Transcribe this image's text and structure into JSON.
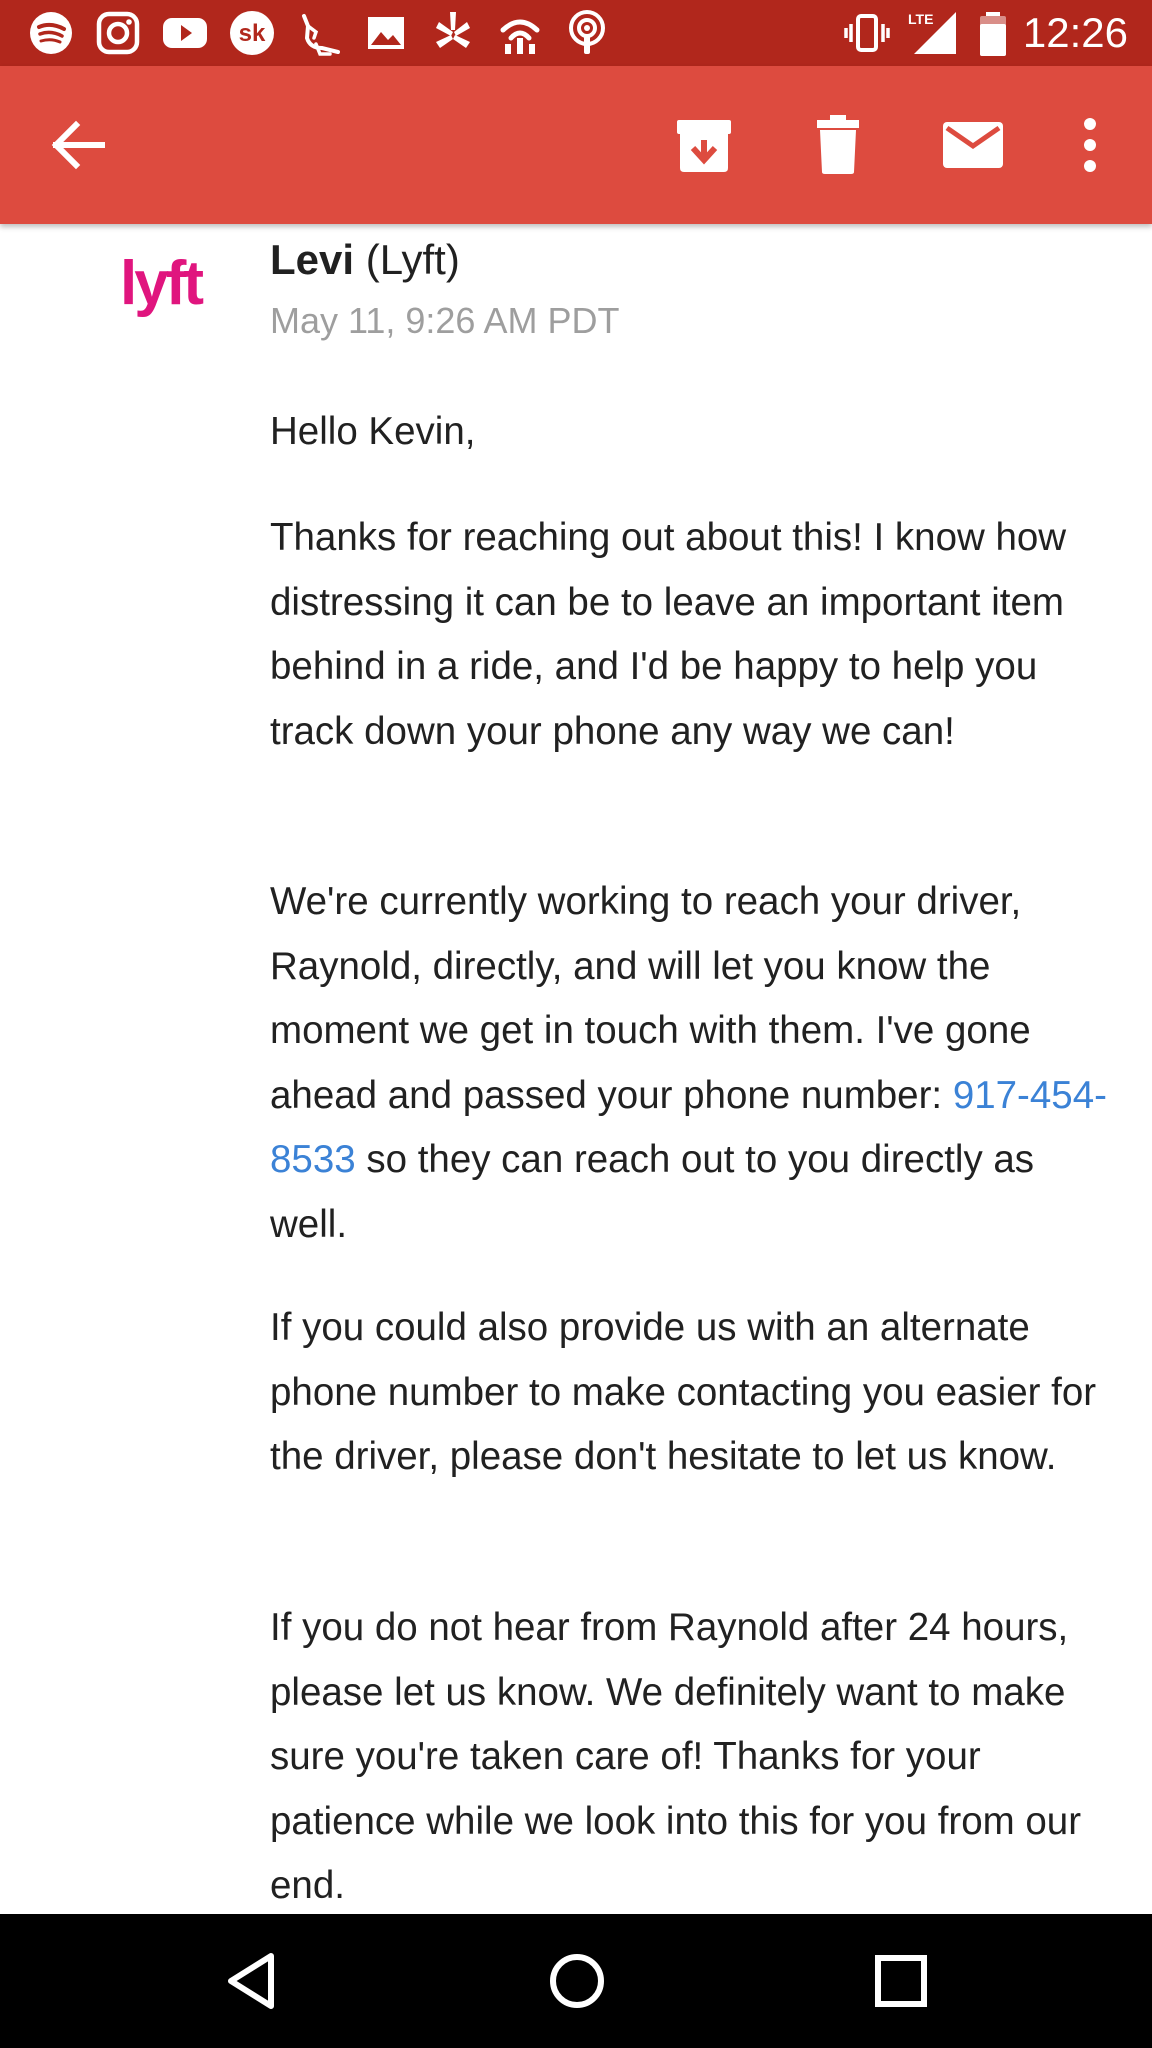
{
  "status_bar": {
    "notification_icons": [
      "spotify-icon",
      "instagram-icon",
      "youtube-icon",
      "songkick-icon",
      "kangaroo-icon",
      "photos-icon",
      "yelp-icon",
      "wifi-hotspot-icon",
      "podcast-icon"
    ],
    "system_icons": [
      "vibrate-icon",
      "lte-signal-icon",
      "battery-icon"
    ],
    "network_label": "LTE",
    "time": "12:26",
    "background": "#b1271c"
  },
  "app_bar": {
    "background": "#dd4b3f",
    "actions": [
      "back-arrow-icon",
      "archive-icon",
      "delete-icon",
      "mark-unread-icon",
      "more-options-icon"
    ]
  },
  "email": {
    "sender_name": "Levi",
    "sender_org": "(Lyft)",
    "logo_text": "lyft",
    "logo_color": "#e0157e",
    "date": "May 11, 9:26 AM PDT",
    "greeting": "Hello Kevin,",
    "para1": "Thanks for reaching out about this! I know how distressing it can be to leave an important item behind in a ride, and I'd be happy to help you track down your phone any way we can!",
    "para2_before": "We're currently working to reach your driver, Raynold, directly, and will let you know the moment we get in touch with them. I've gone ahead and passed your phone number: ",
    "para2_link": "917-454-8533",
    "para2_after": " so they can reach out to you directly as well.",
    "para3": "If you could also provide us with an alternate phone number to make contacting you easier for the driver, please don't hesitate to let us know.",
    "para4": "If you do not hear from Raynold after 24 hours, please let us know. We definitely want to make sure you're taken care of! Thanks for your patience while we look into this for you from our end.",
    "link_color": "#3b82d6"
  },
  "nav_bar": {
    "buttons": [
      "back-triangle-icon",
      "home-circle-icon",
      "recents-square-icon"
    ]
  }
}
